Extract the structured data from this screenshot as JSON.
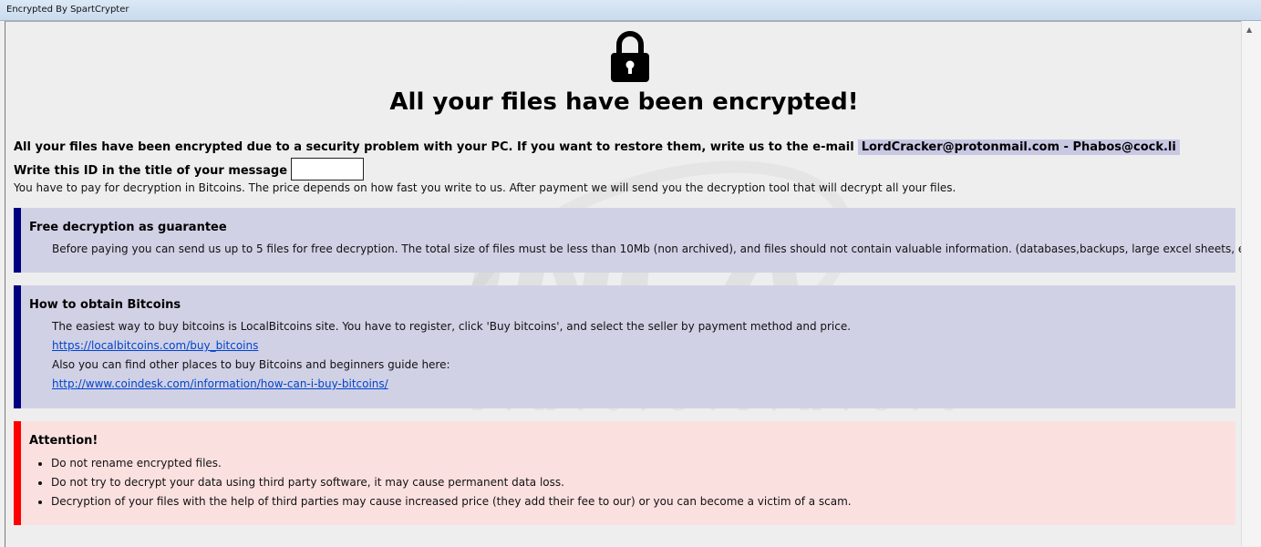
{
  "window": {
    "title": "Encrypted By SpartCrypter"
  },
  "icons": {
    "lock": "padlock-icon",
    "scroll_up": "scroll-up-arrow-icon"
  },
  "colors": {
    "info_bar": "#000080",
    "info_bg": "#d1d1e6",
    "warning_bar": "#ff0000",
    "warning_bg": "#fbe0e0",
    "email_highlight": "#c8c8e4",
    "link": "#0044cc"
  },
  "header": {
    "title": "All your files have been encrypted!"
  },
  "message": {
    "line1": "All your files have been encrypted due to a security problem with your PC. If you want to restore them, write us to the e-mail",
    "email": "LordCracker@protonmail.com - Phabos@cock.li",
    "line2": "Write this ID in the title of your message",
    "id_value": "",
    "line3": "You have to pay for decryption in Bitcoins. The price depends on how fast you write to us. After payment we will send you the decryption tool that will decrypt all your files."
  },
  "guarantee": {
    "title": "Free decryption as guarantee",
    "text": "Before paying you can send us up to 5 files for free decryption. The total size of files must be less than 10Mb (non archived), and files should not contain valuable information. (databases,backups, large excel sheets, etc.)"
  },
  "bitcoins": {
    "title": "How to obtain Bitcoins",
    "text1": "The easiest way to buy bitcoins is LocalBitcoins site. You have to register, click 'Buy bitcoins', and select the seller by payment method and price.",
    "link1": "https://localbitcoins.com/buy_bitcoins",
    "text2": "Also you can find other places to buy Bitcoins and beginners guide here:",
    "link2": "http://www.coindesk.com/information/how-can-i-buy-bitcoins/"
  },
  "attention": {
    "title": "Attention!",
    "items": [
      "Do not rename encrypted files.",
      "Do not try to decrypt your data using third party software, it may cause permanent data loss.",
      "Decryption of your files with the help of third parties may cause increased price (they add their fee to our) or you can become a victim of a scam."
    ]
  },
  "watermark": {
    "logo": "INCA",
    "tagline": "I.n.t.e.r.n.e.t"
  }
}
